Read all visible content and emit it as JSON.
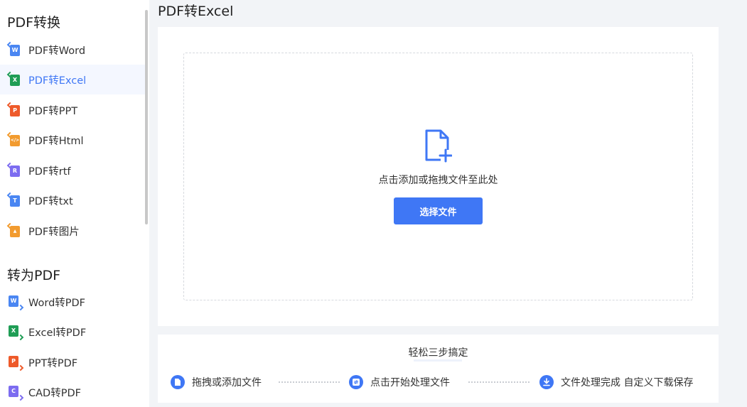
{
  "sidebar": {
    "section_from_title": "PDF转换",
    "from_items": [
      {
        "label": "PDF转Word",
        "icon": "word-file-icon",
        "badge": "W",
        "color": "#4a86f2"
      },
      {
        "label": "PDF转Excel",
        "icon": "excel-file-icon",
        "badge": "X",
        "color": "#1f9d55",
        "active": true
      },
      {
        "label": "PDF转PPT",
        "icon": "ppt-file-icon",
        "badge": "P",
        "color": "#ee5a2a"
      },
      {
        "label": "PDF转Html",
        "icon": "html-file-icon",
        "badge": "</>",
        "color": "#f29b2f"
      },
      {
        "label": "PDF转rtf",
        "icon": "rtf-file-icon",
        "badge": "R",
        "color": "#7c6cf0"
      },
      {
        "label": "PDF转txt",
        "icon": "txt-file-icon",
        "badge": "T",
        "color": "#4a86f2"
      },
      {
        "label": "PDF转图片",
        "icon": "image-file-icon",
        "badge": "▲",
        "color": "#f29b2f"
      }
    ],
    "section_to_title": "转为PDF",
    "to_items": [
      {
        "label": "Word转PDF",
        "icon": "word-file-icon",
        "badge": "W",
        "color": "#4a86f2"
      },
      {
        "label": "Excel转PDF",
        "icon": "excel-file-icon",
        "badge": "X",
        "color": "#1f9d55"
      },
      {
        "label": "PPT转PDF",
        "icon": "ppt-file-icon",
        "badge": "P",
        "color": "#ee5a2a"
      },
      {
        "label": "CAD转PDF",
        "icon": "cad-file-icon",
        "badge": "C",
        "color": "#7c6cf0"
      }
    ]
  },
  "main": {
    "page_title": "PDF转Excel",
    "drop_hint": "点击添加或拖拽文件至此处",
    "select_button": "选择文件",
    "steps_title": "轻松三步搞定",
    "steps": [
      {
        "label": "拖拽或添加文件",
        "icon": "file-icon"
      },
      {
        "label": "点击开始处理文件",
        "icon": "convert-icon"
      },
      {
        "label": "文件处理完成 自定义下载保存",
        "icon": "download-icon"
      }
    ]
  },
  "colors": {
    "accent": "#3f77f5",
    "sidebar_active_bg": "#f4f7ff",
    "page_bg": "#f2f4f7"
  }
}
